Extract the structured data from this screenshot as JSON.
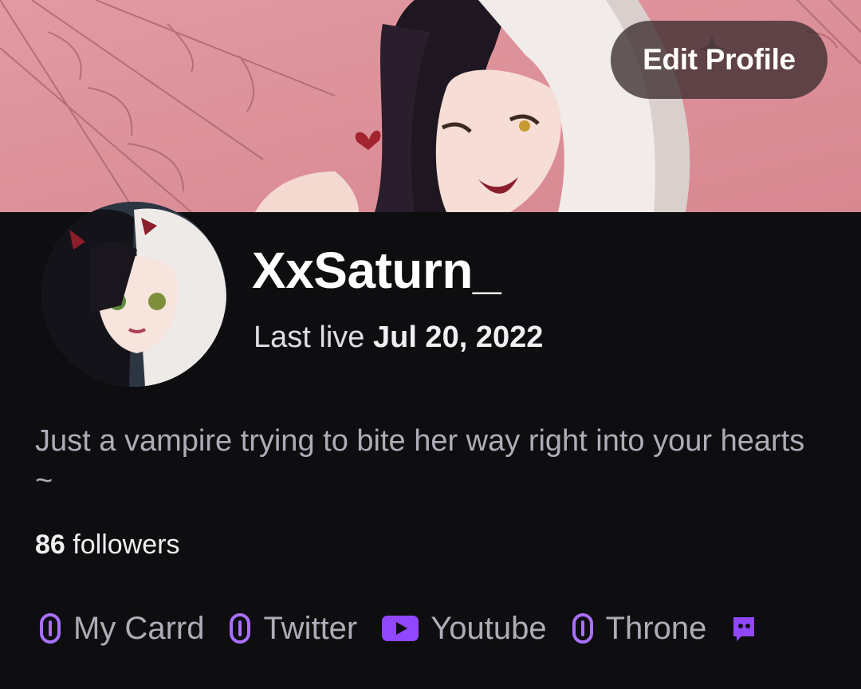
{
  "profile": {
    "edit_button": "Edit Profile",
    "username": "XxSaturn_",
    "last_live_label": "Last live",
    "last_live_date": "Jul 20, 2022",
    "bio": "Just a vampire trying to bite her way right into your hearts ~",
    "followers_count": "86",
    "followers_label": "followers"
  },
  "links": [
    {
      "label": "My Carrd",
      "icon": "link-icon"
    },
    {
      "label": "Twitter",
      "icon": "link-icon"
    },
    {
      "label": "Youtube",
      "icon": "youtube-icon"
    },
    {
      "label": "Throne",
      "icon": "link-icon"
    }
  ],
  "colors": {
    "background": "#0e0e10",
    "accent": "#9147ff",
    "banner": "#dc8f97",
    "muted_text": "#adadb8"
  }
}
